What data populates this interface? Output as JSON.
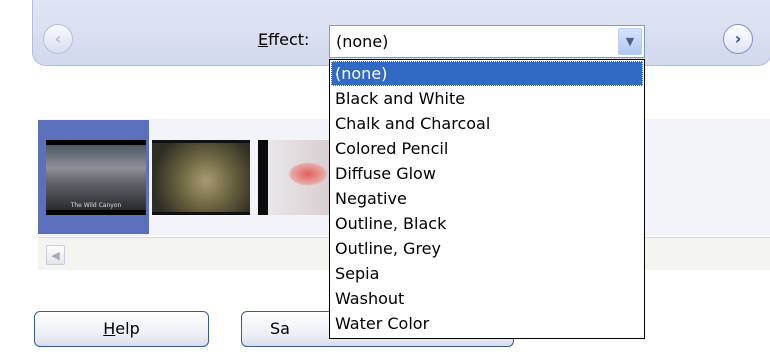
{
  "toolbar": {
    "effect_label_accel": "E",
    "effect_label_rest": "ffect:",
    "selected_effect": "(none)"
  },
  "dropdown": {
    "options": [
      "(none)",
      "Black and White",
      "Chalk and Charcoal",
      "Colored Pencil",
      "Diffuse Glow",
      "Negative",
      "Outline, Black",
      "Outline, Grey",
      "Sepia",
      "Washout",
      "Water Color"
    ],
    "highlighted_index": 0
  },
  "filmstrip": {
    "thumb1_caption": "The Wild Canyon"
  },
  "buttons": {
    "help_accel": "H",
    "help_rest": "elp",
    "save_label": "Sa"
  },
  "colors": {
    "selection": "#316ac5",
    "panel": "#d3d9ee",
    "filmstrip_selected": "#5b6fbb"
  },
  "icons": {
    "prev": "back-arrow-icon",
    "next": "forward-arrow-icon",
    "dropdown": "chevron-down-icon",
    "scroll_left": "scroll-left-arrow-icon"
  }
}
